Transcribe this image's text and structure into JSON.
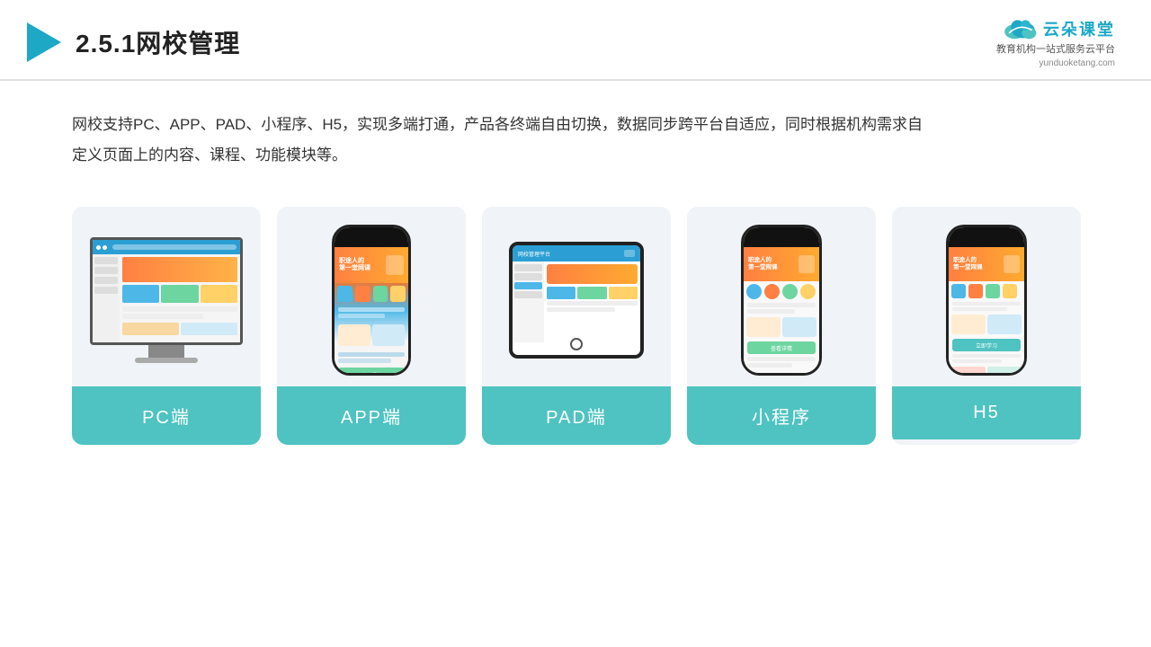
{
  "header": {
    "title": "2.5.1网校管理",
    "logo_main": "云朵课堂",
    "logo_sub_line1": "教育机构一站",
    "logo_sub_line2": "式服务云平台",
    "logo_url": "yunduoketang.com"
  },
  "description": {
    "text": "网校支持PC、APP、PAD、小程序、H5，实现多端打通，产品各终端自由切换，数据同步跨平台自适应，同时根据机构需求自定义页面上的内容、课程、功能模块等。"
  },
  "cards": [
    {
      "id": "pc",
      "label": "PC端"
    },
    {
      "id": "app",
      "label": "APP端"
    },
    {
      "id": "pad",
      "label": "PAD端"
    },
    {
      "id": "miniprogram",
      "label": "小程序"
    },
    {
      "id": "h5",
      "label": "H5"
    }
  ]
}
